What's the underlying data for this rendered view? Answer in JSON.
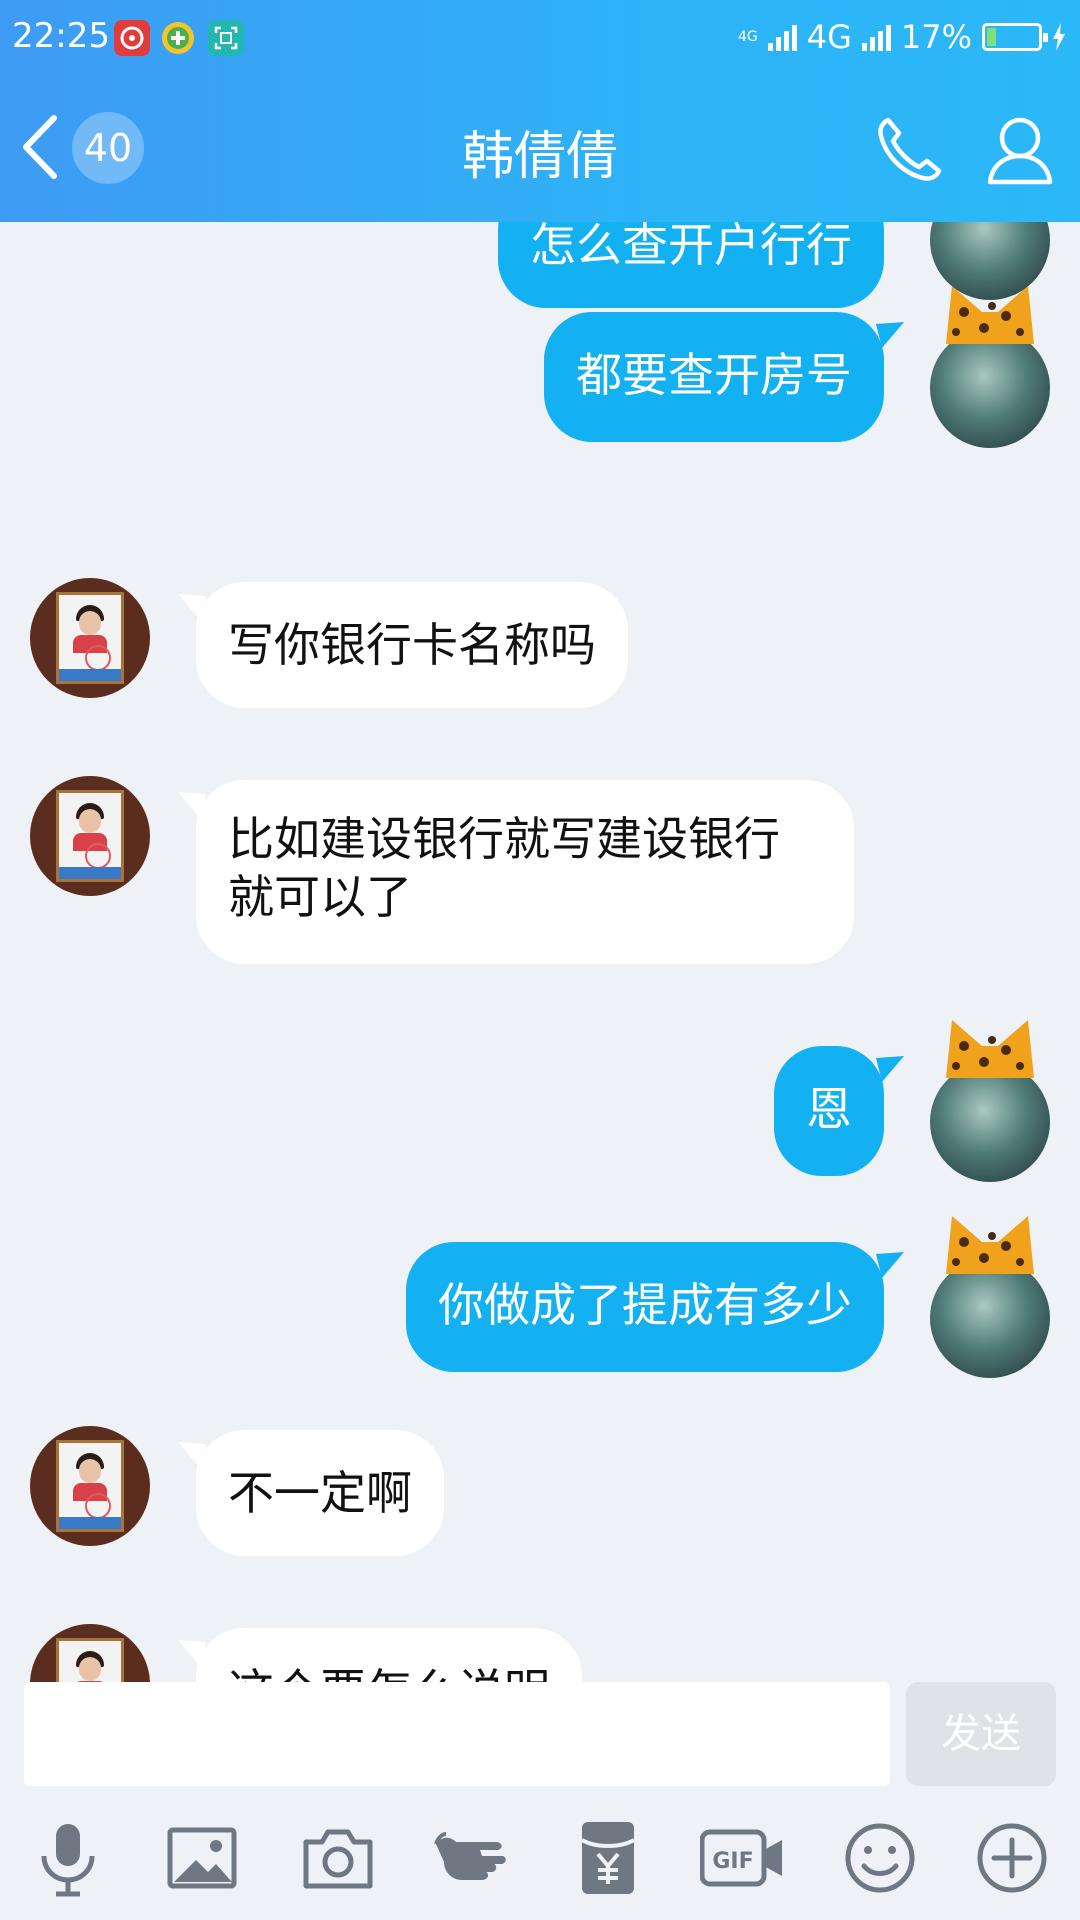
{
  "status_bar": {
    "time": "22:25",
    "network_small": "4G",
    "network": "4G",
    "battery": "17%",
    "battery_level": 0.17
  },
  "header": {
    "unread_count": "40",
    "title": "韩倩倩"
  },
  "messages": [
    {
      "side": "out",
      "text": "怎么查开户行行"
    },
    {
      "side": "out",
      "text": "都要查开房号"
    },
    {
      "side": "in",
      "text": "写你银行卡名称吗"
    },
    {
      "side": "in",
      "lines": [
        "比如建设银行就写建设银行",
        "就可以了"
      ]
    },
    {
      "side": "out",
      "text": "恩"
    },
    {
      "side": "out",
      "text": "你做成了提成有多少"
    },
    {
      "side": "in",
      "text": "不一定啊"
    },
    {
      "side": "in",
      "text": "这个要怎么说明"
    }
  ],
  "composer": {
    "value": "",
    "send_label": "发送"
  },
  "toolbar": {
    "gif_label": "GIF",
    "icons": [
      "microphone-icon",
      "image-icon",
      "camera-icon",
      "poke-icon",
      "red-packet-icon",
      "gif-icon",
      "emoji-icon",
      "plus-icon"
    ]
  },
  "colors": {
    "header_gradient_start": "#3e9bf3",
    "header_gradient_end": "#2ab8f8",
    "outgoing_bubble": "#14b1f2",
    "incoming_bubble": "#ffffff",
    "chat_background": "#eef1f6"
  }
}
